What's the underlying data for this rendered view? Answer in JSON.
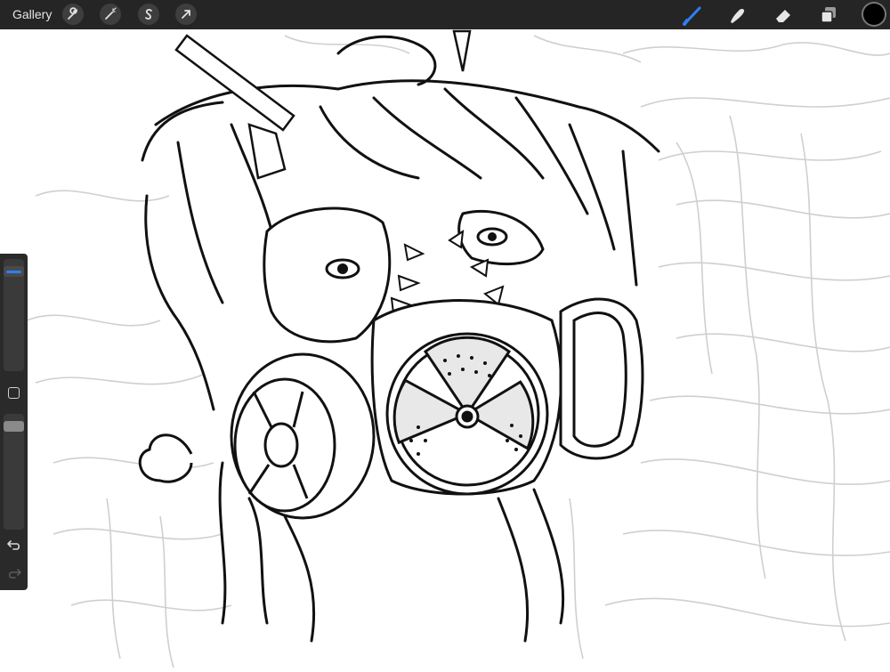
{
  "app": {
    "gallery_label": "Gallery"
  },
  "toolbar": {
    "left_tools": [
      "actions-wrench-icon",
      "adjustments-wand-icon",
      "selection-s-icon",
      "transform-arrow-icon"
    ],
    "right_tools": [
      "brush-icon",
      "smudge-icon",
      "eraser-icon",
      "layers-icon"
    ],
    "active_tool": "brush-icon",
    "accent_color": "#2f7ef5",
    "current_color": "#000000"
  },
  "sidebar": {
    "brush_size_level": 0.95,
    "opacity_level": 0.95,
    "controls": [
      "brush-size-slider",
      "modify-button",
      "opacity-slider",
      "undo-icon",
      "redo-icon"
    ]
  }
}
